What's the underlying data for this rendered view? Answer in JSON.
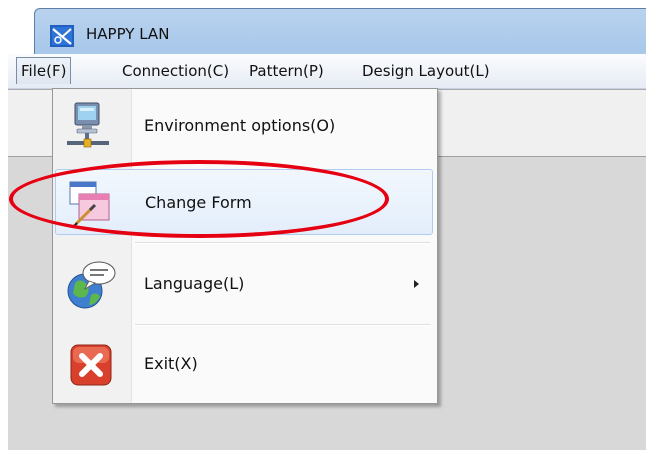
{
  "window": {
    "title": "HAPPY LAN",
    "app_icon": "happy-lan-logo-icon"
  },
  "menu_bar": {
    "items": [
      {
        "label": "File(F)",
        "active": true
      },
      {
        "label": "Connection(C)",
        "active": false
      },
      {
        "label": "Pattern(P)",
        "active": false
      },
      {
        "label": "Design Layout(L)",
        "active": false
      }
    ]
  },
  "file_menu": {
    "items": [
      {
        "label": "Environment options(O)",
        "icon": "network-computer-icon",
        "highlighted": false,
        "has_submenu": false
      },
      {
        "label": "Change Form",
        "icon": "change-form-icon",
        "highlighted": true,
        "has_submenu": false
      },
      {
        "label": "Language(L)",
        "icon": "globe-speech-icon",
        "highlighted": false,
        "has_submenu": true
      },
      {
        "label": "Exit(X)",
        "icon": "exit-x-icon",
        "highlighted": false,
        "has_submenu": false
      }
    ]
  },
  "annotation": {
    "color": "#e50012",
    "target": "Change Form"
  },
  "colors": {
    "title_bar": "#a9c8ea",
    "highlight_border": "#b0cdf0",
    "exit_red": "#d9402b"
  }
}
